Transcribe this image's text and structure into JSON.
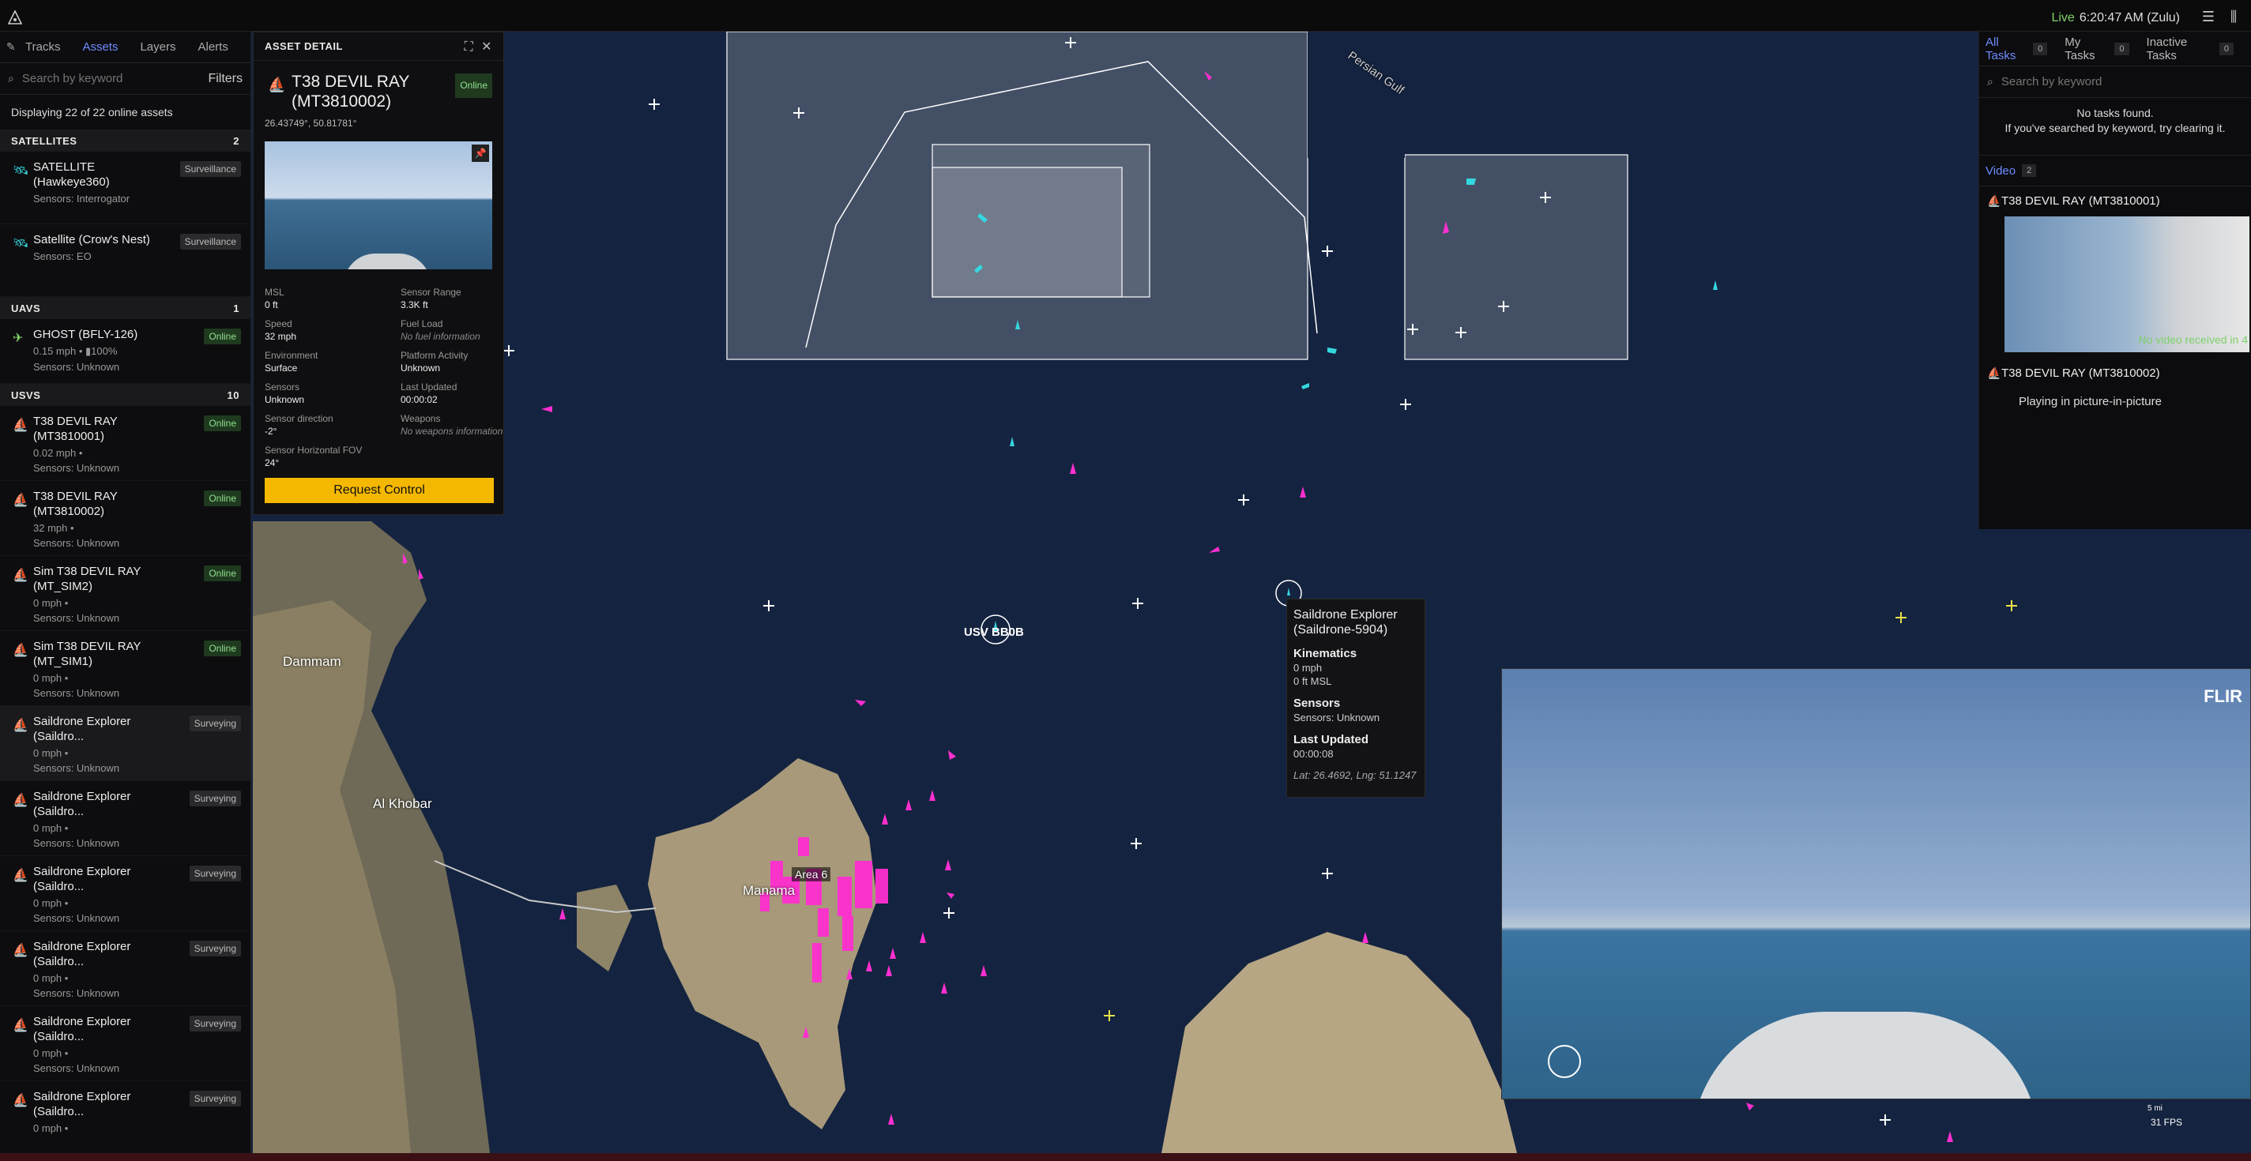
{
  "topbar": {
    "live": "Live",
    "time": "6:20:47 AM (Zulu)"
  },
  "left": {
    "tabs": [
      "Tracks",
      "Assets",
      "Layers",
      "Alerts"
    ],
    "search_placeholder": "Search by keyword",
    "filters_label": "Filters",
    "displaying": "Displaying 22 of 22 online assets",
    "sections": {
      "satellites": {
        "title": "SATELLITES",
        "count": "2"
      },
      "uavs": {
        "title": "UAVS",
        "count": "1"
      },
      "usvs": {
        "title": "USVS",
        "count": "10"
      }
    },
    "satellites": [
      {
        "name": "SATELLITE (Hawkeye360)",
        "meta": "Sensors: Interrogator",
        "badge": "Surveillance"
      },
      {
        "name": "Satellite (Crow's Nest)",
        "meta": "Sensors: EO",
        "badge": "Surveillance"
      }
    ],
    "uavs": [
      {
        "name": "GHOST (BFLY-126)",
        "meta1": "0.15 mph • ▮100%",
        "meta2": "Sensors: Unknown",
        "badge": "Online"
      }
    ],
    "usvs": [
      {
        "name": "T38 DEVIL RAY (MT3810001)",
        "meta1": "0.02 mph •",
        "meta2": "Sensors: Unknown",
        "badge": "Online"
      },
      {
        "name": "T38 DEVIL RAY (MT3810002)",
        "meta1": "32 mph •",
        "meta2": "Sensors: Unknown",
        "badge": "Online"
      },
      {
        "name": "Sim T38 DEVIL RAY (MT_SIM2)",
        "meta1": "0 mph •",
        "meta2": "Sensors: Unknown",
        "badge": "Online"
      },
      {
        "name": "Sim T38 DEVIL RAY (MT_SIM1)",
        "meta1": "0 mph •",
        "meta2": "Sensors: Unknown",
        "badge": "Online"
      },
      {
        "name": "Saildrone Explorer (Saildro...",
        "meta1": "0 mph •",
        "meta2": "Sensors: Unknown",
        "badge": "Surveying"
      },
      {
        "name": "Saildrone Explorer (Saildro...",
        "meta1": "0 mph •",
        "meta2": "Sensors: Unknown",
        "badge": "Surveying"
      },
      {
        "name": "Saildrone Explorer (Saildro...",
        "meta1": "0 mph •",
        "meta2": "Sensors: Unknown",
        "badge": "Surveying"
      },
      {
        "name": "Saildrone Explorer (Saildro...",
        "meta1": "0 mph •",
        "meta2": "Sensors: Unknown",
        "badge": "Surveying"
      },
      {
        "name": "Saildrone Explorer (Saildro...",
        "meta1": "0 mph •",
        "meta2": "Sensors: Unknown",
        "badge": "Surveying"
      },
      {
        "name": "Saildrone Explorer (Saildro...",
        "meta1": "0 mph •",
        "meta2": "",
        "badge": "Surveying"
      }
    ]
  },
  "detail": {
    "header": "ASSET DETAIL",
    "name": "T38 DEVIL RAY (MT3810002)",
    "status": "Online",
    "coords": "26.43749°, 50.81781°",
    "fields": [
      {
        "k": "MSL",
        "v": "0 ft",
        "muted": false
      },
      {
        "k": "Sensor Range",
        "v": "3.3K ft",
        "muted": false
      },
      {
        "k": "Speed",
        "v": "32 mph",
        "muted": false
      },
      {
        "k": "Fuel Load",
        "v": "No fuel information",
        "muted": true
      },
      {
        "k": "Environment",
        "v": "Surface",
        "muted": false
      },
      {
        "k": "Platform Activity",
        "v": "Unknown",
        "muted": false
      },
      {
        "k": "Sensors",
        "v": "Unknown",
        "muted": false
      },
      {
        "k": "Last Updated",
        "v": "00:00:02",
        "muted": false
      },
      {
        "k": "Sensor direction",
        "v": "-2°",
        "muted": false
      },
      {
        "k": "Weapons",
        "v": "No weapons information",
        "muted": true
      },
      {
        "k": "Sensor Horizontal FOV",
        "v": "24°",
        "muted": false
      }
    ],
    "request_label": "Request Control"
  },
  "tasks": {
    "tabs": [
      {
        "label": "All Tasks",
        "count": "0"
      },
      {
        "label": "My Tasks",
        "count": "0"
      },
      {
        "label": "Inactive Tasks",
        "count": "0"
      }
    ],
    "search_placeholder": "Search by keyword",
    "empty_title": "No tasks found.",
    "empty_hint": "If you've searched by keyword, try clearing it.",
    "video_label": "Video",
    "video_count": "2",
    "video1": "T38 DEVIL RAY (MT3810001)",
    "video1_overlay": "No video received in 4",
    "video2": "T38 DEVIL RAY (MT3810002)",
    "pip_note": "Playing in picture-in-picture"
  },
  "map": {
    "gulf_label": "Persian Gulf",
    "usv_label": "USV BB0B",
    "area_label": "Area 6",
    "cities": [
      "Dammam",
      "Al Khobar",
      "Manama"
    ]
  },
  "tooltip": {
    "title": "Saildrone Explorer (Saildrone-5904)",
    "kin_h": "Kinematics",
    "kin_v1": "0 mph",
    "kin_v2": "0 ft MSL",
    "sens_h": "Sensors",
    "sens_v": "Sensors: Unknown",
    "upd_h": "Last Updated",
    "upd_v": "00:00:08",
    "pos": "Lat: 26.4692, Lng: 51.1247"
  },
  "video": {
    "brand": "FLIR",
    "fps": "31 FPS",
    "scale": "5 mi"
  },
  "colors": {
    "accent": "#6e8cff",
    "usv": "#34d7e0",
    "track": "#ff2fd0",
    "request": "#f5b800",
    "online": "#8fe08f"
  }
}
